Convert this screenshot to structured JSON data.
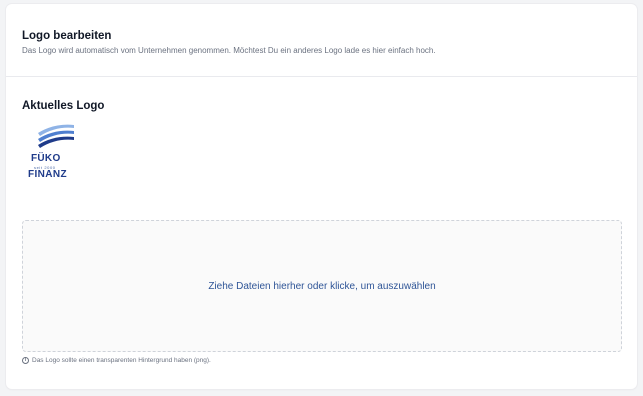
{
  "header": {
    "title": "Logo bearbeiten",
    "description": "Das Logo wird automatisch vom Unternehmen genommen. Möchtest Du ein anderes Logo lade es hier einfach hoch."
  },
  "current_logo": {
    "title": "Aktuelles Logo",
    "brand_top": "FÜKO",
    "brand_sub": "seit 2000",
    "brand_bottom": "FINANZ"
  },
  "dropzone": {
    "label": "Ziehe Dateien hierher oder klicke, um auszuwählen"
  },
  "hint": {
    "icon": "info-icon",
    "text": "Das Logo sollte einen transparenten Hintergrund haben (png)."
  },
  "colors": {
    "accent": "#2f5597",
    "brand_blue": "#1f3b8a",
    "swoosh_light": "#8fb3e6"
  }
}
